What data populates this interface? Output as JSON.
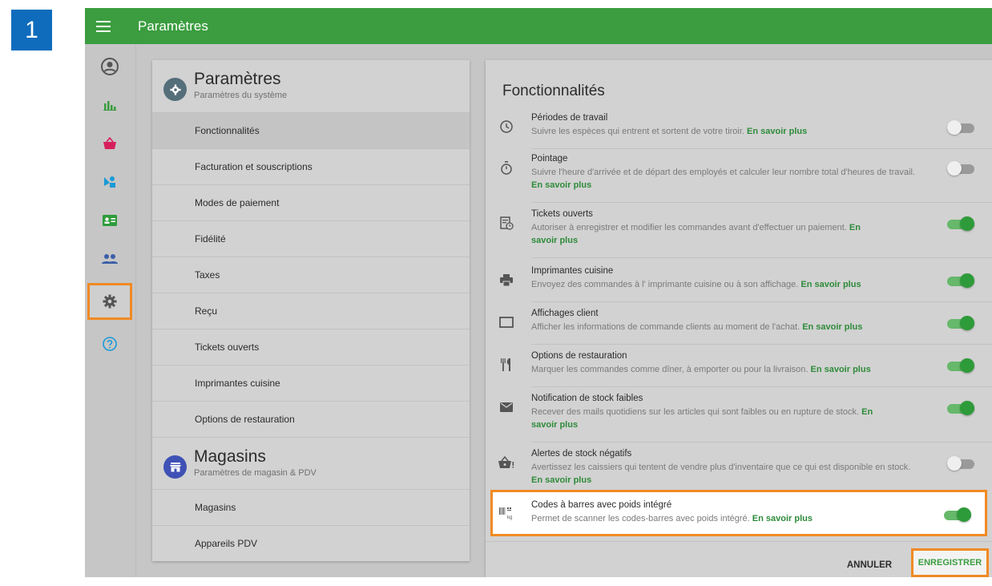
{
  "step_badge": "1",
  "topbar": {
    "title": "Paramètres",
    "menu_icon": "hamburger-icon",
    "color": "#3b9d3f"
  },
  "rail": {
    "items": [
      {
        "icon": "account-circle-icon",
        "active": false
      },
      {
        "icon": "bar-chart-icon",
        "active": false
      },
      {
        "icon": "basket-icon",
        "active": false
      },
      {
        "icon": "shapes-icon",
        "active": false
      },
      {
        "icon": "contact-card-icon",
        "active": false
      },
      {
        "icon": "people-icon",
        "active": false
      },
      {
        "icon": "gear-icon",
        "active": true
      },
      {
        "icon": "help-icon",
        "active": false
      }
    ]
  },
  "settings_section": {
    "title": "Paramètres",
    "subtitle": "Paramètres du système",
    "items": [
      "Fonctionnalités",
      "Facturation et souscriptions",
      "Modes de paiement",
      "Fidélité",
      "Taxes",
      "Reçu",
      "Tickets ouverts",
      "Imprimantes cuisine",
      "Options de restauration"
    ],
    "active_item": "Fonctionnalités"
  },
  "stores_section": {
    "title": "Magasins",
    "subtitle": "Paramètres de magasin & PDV",
    "items": [
      "Magasins",
      "Appareils PDV"
    ]
  },
  "features": {
    "title": "Fonctionnalités",
    "more_label": "En savoir plus",
    "items": [
      {
        "icon": "clock-icon",
        "title": "Périodes de travail",
        "desc": "Suivre les espèces qui entrent et sortent de votre tiroir.",
        "on": false
      },
      {
        "icon": "stopwatch-icon",
        "title": "Pointage",
        "desc": "Suivre l'heure d'arrivée et de départ des employés et calculer leur nombre total d'heures de travail.",
        "on": false
      },
      {
        "icon": "ticket-clock-icon",
        "title": "Tickets ouverts",
        "desc": "Autoriser à enregistrer et modifier les commandes avant d'effectuer un paiement.",
        "on": true
      },
      {
        "icon": "printer-icon",
        "title": "Imprimantes cuisine",
        "desc": "Envoyez des commandes à l' imprimante cuisine ou à son affichage.",
        "on": true
      },
      {
        "icon": "monitor-icon",
        "title": "Affichages client",
        "desc": "Afficher les informations de commande clients au moment de l'achat.",
        "on": true
      },
      {
        "icon": "utensils-icon",
        "title": "Options de restauration",
        "desc": "Marquer les commandes comme dîner, à emporter ou pour la livraison.",
        "on": true
      },
      {
        "icon": "mail-icon",
        "title": "Notification de stock faibles",
        "desc": "Recever des mails quotidiens sur les articles qui sont faibles ou en rupture de stock.",
        "on": true
      },
      {
        "icon": "basket-alert-icon",
        "title": "Alertes de stock négatifs",
        "desc": "Avertissez les caissiers qui tentent de vendre plus d'inventaire que ce qui est disponible en stock.",
        "on": false
      },
      {
        "icon": "barcode-weight-icon",
        "title": "Codes à barres avec poids intégré",
        "desc": "Permet de scanner les codes-barres avec poids intégré.",
        "on": true
      }
    ]
  },
  "actions": {
    "cancel": "ANNULER",
    "save": "ENREGISTRER"
  },
  "colors": {
    "accent_green": "#3b9d3f",
    "highlight_orange": "#f08a24",
    "badge_blue": "#0f6cbd"
  }
}
